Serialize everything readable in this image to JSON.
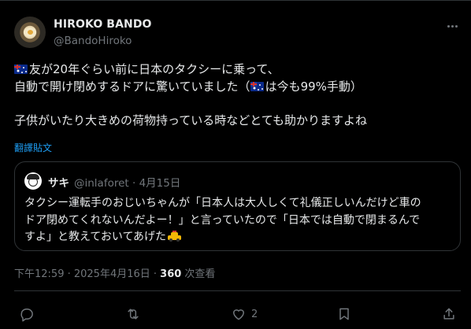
{
  "author": {
    "display_name": "HIROKO BANDO",
    "handle": "@BandoHiroko"
  },
  "tweet": {
    "line1": "友が20年ぐらい前に日本のタクシーに乗って、",
    "line2a": "自動で開け閉めするドアに驚いていました（",
    "line2b": "は今も99%手動）",
    "line3": "子供がいたり大きめの荷物持っている時などとても助かりますよね"
  },
  "translate_label": "翻譯貼文",
  "quote": {
    "name": "サキ",
    "handle_date": "@inlaforet · 4月15日",
    "line1": "タクシー運転手のおじいちゃんが「日本人は大人しくて礼儀正しいんだけど車の",
    "line2": "ドア閉めてくれないんだよー！」と言っていたので「日本では自動で閉まるんで",
    "line3": "すよ」と教えておいてあげた"
  },
  "meta": {
    "timestamp": "下午12:59 · 2025年4月16日 · ",
    "views_count": "360",
    "views_label": " 次查看"
  },
  "actions": {
    "reply_count": "",
    "retweet_count": "",
    "like_count": "2",
    "bookmark_count": ""
  },
  "colors": {
    "background": "#000000",
    "text_primary": "#e7e9ea",
    "text_secondary": "#71767b",
    "link": "#1d9bf0",
    "border": "#2f3336"
  },
  "icons": [
    "flag-australia-icon",
    "taxi-emoji-icon",
    "more-icon",
    "reply-icon",
    "retweet-icon",
    "like-icon",
    "bookmark-icon",
    "share-icon"
  ]
}
